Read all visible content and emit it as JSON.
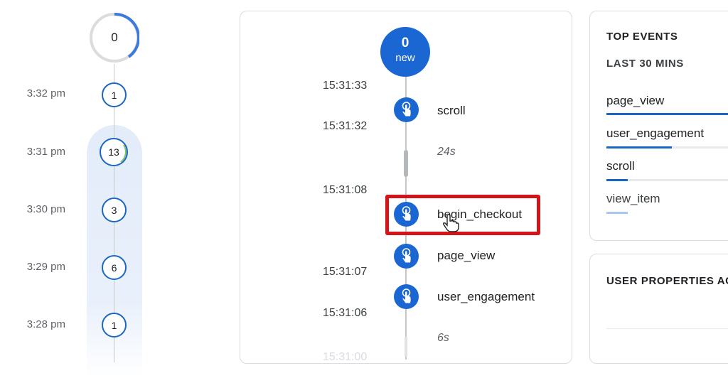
{
  "minute_timeline": {
    "top_count": "0",
    "rows": [
      {
        "time": "3:32 pm",
        "count": "1"
      },
      {
        "time": "3:31 pm",
        "count": "13"
      },
      {
        "time": "3:30 pm",
        "count": "3"
      },
      {
        "time": "3:29 pm",
        "count": "6"
      },
      {
        "time": "3:28 pm",
        "count": "1"
      }
    ]
  },
  "event_stream": {
    "new_count": "0",
    "new_label": "new",
    "timestamps": [
      "15:31:33",
      "15:31:32",
      "15:31:08",
      "15:31:07",
      "15:31:06",
      "15:31:00"
    ],
    "events": [
      {
        "name": "scroll",
        "icon": "touch-icon"
      },
      {
        "name": "begin_checkout",
        "icon": "touch-icon",
        "highlighted": true
      },
      {
        "name": "page_view",
        "icon": "touch-icon"
      },
      {
        "name": "user_engagement",
        "icon": "touch-icon"
      }
    ],
    "durations": [
      "24s",
      "6s"
    ],
    "highlight_color": "#d3151a"
  },
  "top_events": {
    "title": "TOP EVENTS",
    "subtitle": "LAST 30 MINS",
    "items": [
      {
        "name": "page_view",
        "share": 1.0
      },
      {
        "name": "user_engagement",
        "share": 0.46
      },
      {
        "name": "scroll",
        "share": 0.15
      },
      {
        "name": "view_item",
        "share": 0.15
      }
    ]
  },
  "user_properties": {
    "title": "USER PROPERTIES AC"
  },
  "colors": {
    "accent": "#1a66d2",
    "highlight": "#d3151a"
  }
}
